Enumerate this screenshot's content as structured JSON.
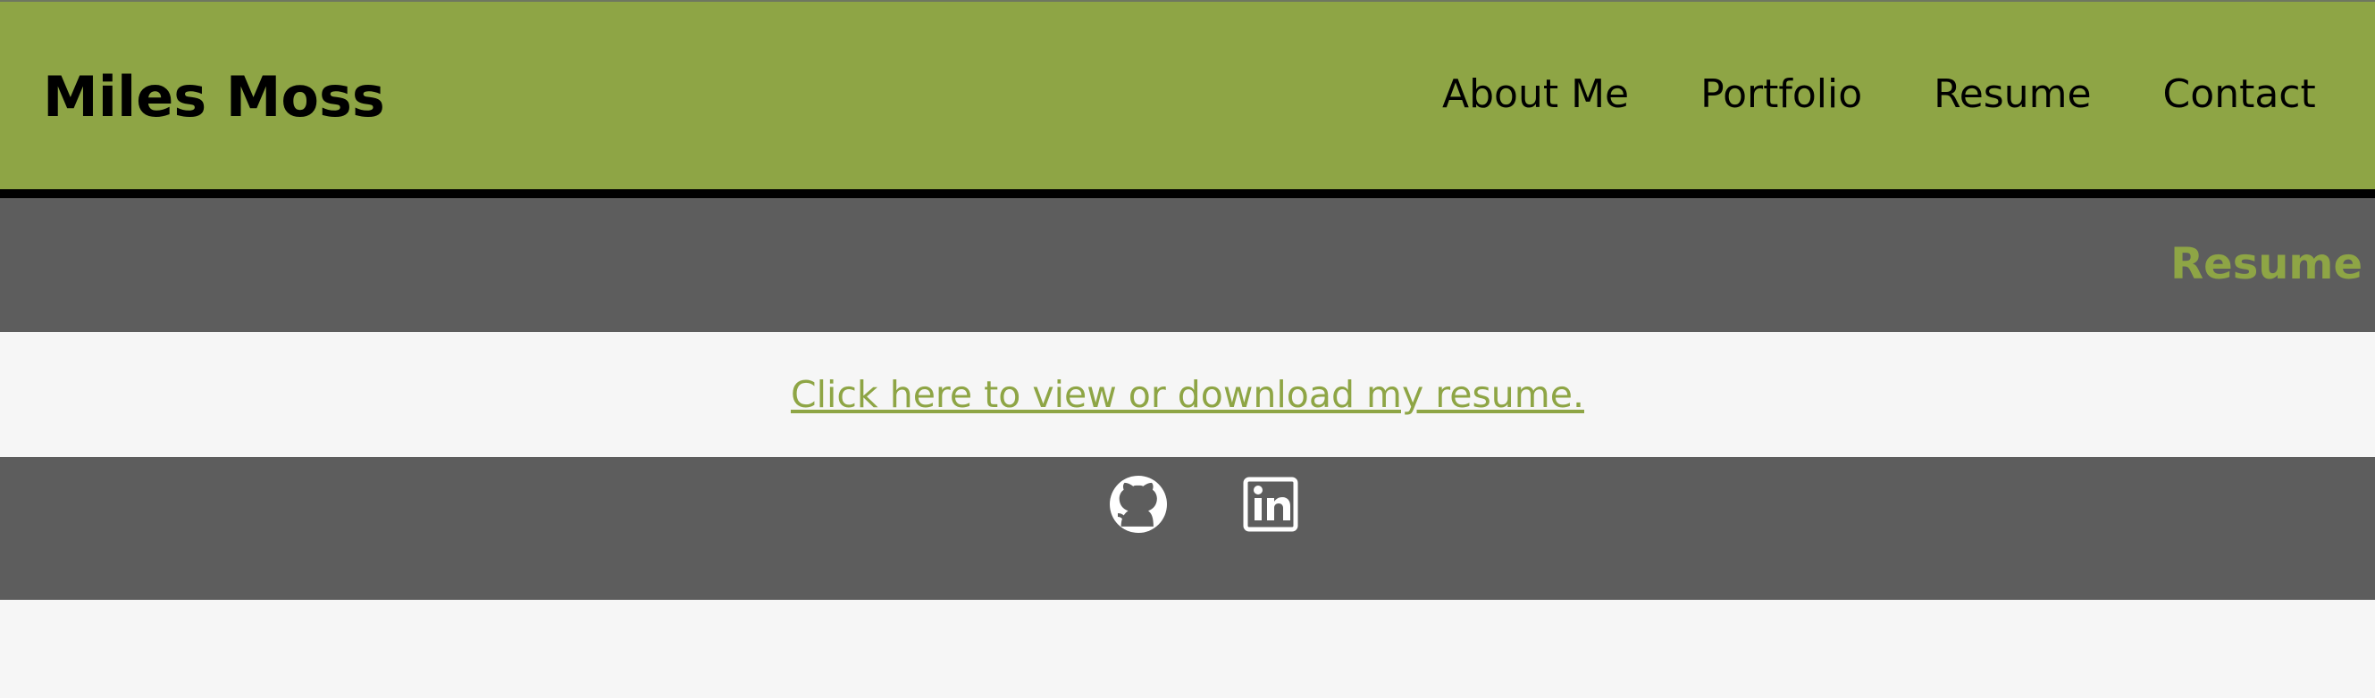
{
  "site": {
    "brand": "Miles Moss"
  },
  "nav": {
    "items": [
      {
        "label": "About Me"
      },
      {
        "label": "Portfolio"
      },
      {
        "label": "Resume"
      },
      {
        "label": "Contact"
      }
    ]
  },
  "section": {
    "title": "Resume"
  },
  "content": {
    "resume_link": "Click here to view or download my resume."
  },
  "footer": {
    "icons": [
      "github-icon",
      "linkedin-icon"
    ]
  },
  "colors": {
    "accent": "#8ea545",
    "dark": "#5d5d5d",
    "light": "#f6f6f6",
    "text": "#000000",
    "icon": "#ffffff"
  }
}
